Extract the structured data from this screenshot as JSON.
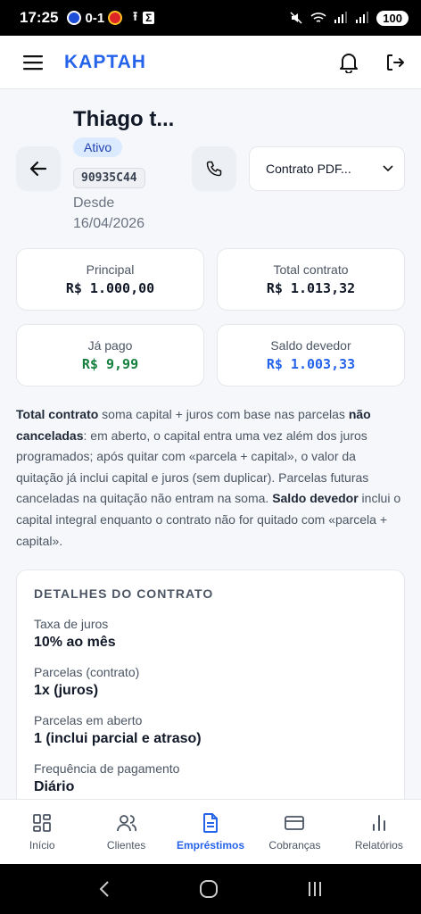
{
  "status_bar": {
    "time": "17:25",
    "score": "0-1",
    "battery": "100"
  },
  "header": {
    "brand": "KAPTAH"
  },
  "profile": {
    "name": "Thiago t...",
    "status": "Ativo",
    "code": "90935C44",
    "since_label": "Desde",
    "since_date": "16/04/2026",
    "contract_select": "Contrato PDF..."
  },
  "summary": {
    "principal_label": "Principal",
    "principal_value": "R$ 1.000,00",
    "total_label": "Total contrato",
    "total_value": "R$ 1.013,32",
    "paid_label": "Já pago",
    "paid_value": "R$ 9,99",
    "balance_label": "Saldo devedor",
    "balance_value": "R$ 1.003,33"
  },
  "explanation": {
    "p1_bold": "Total contrato",
    "p1": " soma capital + juros com base nas parcelas ",
    "p2_bold": "não canceladas",
    "p2": ": em aberto, o capital entra uma vez além dos juros programados; após quitar com «parcela + capital», o valor da quitação já inclui capital e juros (sem duplicar). Parcelas futuras canceladas na quitação não entram na soma. ",
    "p3_bold": "Saldo devedor",
    "p3": " inclui o capital integral enquanto o contrato não for quitado com «parcela + capital»."
  },
  "details": {
    "title": "DETALHES DO CONTRATO",
    "rows": [
      {
        "label": "Taxa de juros",
        "value": "10% ao mês"
      },
      {
        "label": "Parcelas (contrato)",
        "value": "1x (juros)"
      },
      {
        "label": "Parcelas em aberto",
        "value": "1 (inclui parcial e atraso)"
      },
      {
        "label": "Frequência de pagamento",
        "value": "Diário"
      }
    ]
  },
  "tabs": [
    {
      "label": "Início",
      "icon": "dashboard-icon"
    },
    {
      "label": "Clientes",
      "icon": "users-icon"
    },
    {
      "label": "Empréstimos",
      "icon": "document-icon",
      "active": true
    },
    {
      "label": "Cobranças",
      "icon": "card-icon"
    },
    {
      "label": "Relatórios",
      "icon": "bar-chart-icon"
    }
  ],
  "colors": {
    "accent": "#2563eb",
    "paid": "#15803d",
    "badge_bg": "#dbeafe"
  }
}
